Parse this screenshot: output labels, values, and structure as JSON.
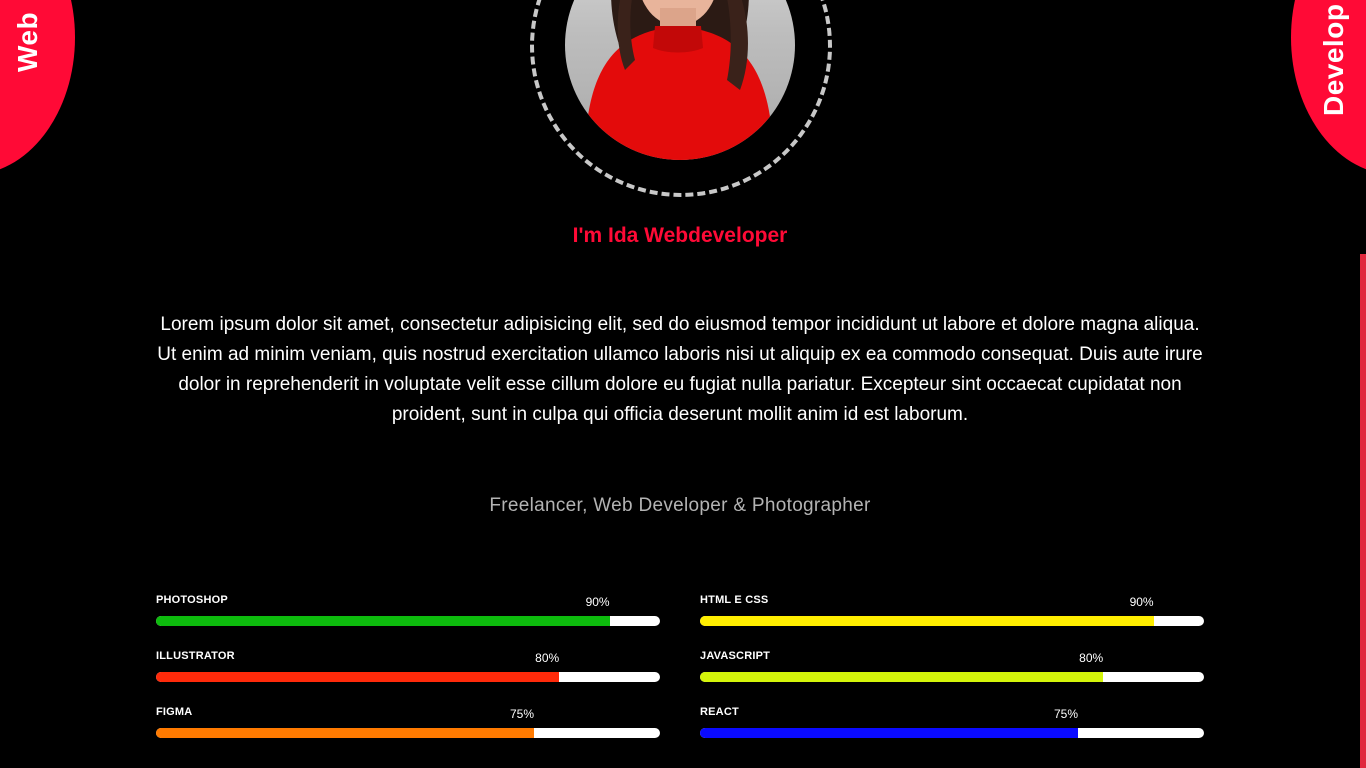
{
  "corners": {
    "left_label": "Web",
    "right_label": "Develop"
  },
  "hero": {
    "title": "I'm Ida Webdeveloper",
    "bio": "Lorem ipsum dolor sit amet, consectetur adipisicing elit, sed do eiusmod tempor incididunt ut labore et dolore magna aliqua. Ut enim ad minim veniam, quis nostrud exercitation ullamco laboris nisi ut aliquip ex ea commodo consequat. Duis aute irure dolor in reprehenderit in voluptate velit esse cillum dolore eu fugiat nulla pariatur. Excepteur sint occaecat cupidatat non proident, sunt in culpa qui officia deserunt mollit anim id est laborum.",
    "roles": "Freelancer, Web Developer & Photographer"
  },
  "colors": {
    "accent": "#ff0a36",
    "background": "#000000"
  },
  "skills": [
    {
      "name": "PHOTOSHOP",
      "percent_label": "90%",
      "percent": 90,
      "color": "#0dbb0d"
    },
    {
      "name": "HTML E CSS",
      "percent_label": "90%",
      "percent": 90,
      "color": "#ffee00"
    },
    {
      "name": "ILLUSTRATOR",
      "percent_label": "80%",
      "percent": 80,
      "color": "#ff2a0a"
    },
    {
      "name": "JAVASCRIPT",
      "percent_label": "80%",
      "percent": 80,
      "color": "#d4f50a"
    },
    {
      "name": "FIGMA",
      "percent_label": "75%",
      "percent": 75,
      "color": "#ff7a00"
    },
    {
      "name": "REACT",
      "percent_label": "75%",
      "percent": 75,
      "color": "#0a0aff"
    }
  ]
}
